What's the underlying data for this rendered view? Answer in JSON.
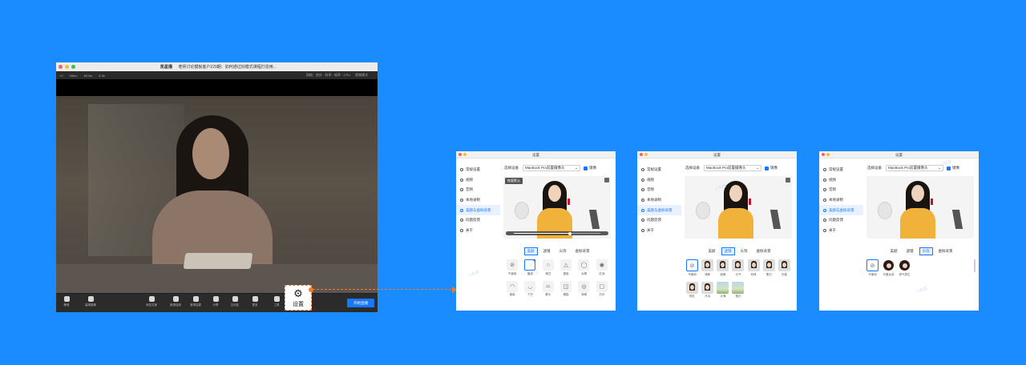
{
  "main_window": {
    "app_name": "凯星播",
    "title": "老师讨论模板客户229期：如何通过好模式课程打造用...",
    "status": {
      "signal": "+0",
      "viewers": "55fen",
      "likes": "89.5w",
      "comments": "5.3k",
      "network": "网络：良好 · 码率 · 帧率 · CPU",
      "mode": "视频模式"
    },
    "toolbar": {
      "items": [
        "静音",
        "高清摄像",
        "添加文案",
        "邀请连线",
        "邀请连麦",
        "分享",
        "互动区",
        "更多",
        "工具"
      ],
      "start_label": "开始直播"
    }
  },
  "callout": {
    "label": "设置"
  },
  "settings": {
    "title": "设置",
    "sidebar": [
      "常规设置",
      "视频",
      "音频",
      "本地录制",
      "美颜与虚拟背景",
      "问题反馈",
      "关于"
    ],
    "active_sidebar": "美颜与虚拟背景",
    "device_label": "选择设备",
    "device_value": "MacBook Pro前置摄像头",
    "mirror_label": "镜像",
    "preview_tag": "恢复默认",
    "watermark": "小鹅通",
    "tabs": [
      "美颜",
      "滤镜",
      "头饰",
      "虚拟背景"
    ],
    "beauty_items": [
      "不使用",
      "磨皮",
      "美白",
      "瘦脸",
      "大眼",
      "红润",
      "瘦鼻",
      "下巴",
      "额头",
      "眼距",
      "亮眼",
      "白牙"
    ],
    "filter_items": [
      "不使用",
      "清新",
      "甜美",
      "元气",
      "珍珠",
      "柔白",
      "白皙",
      "粉红",
      "冷淡",
      "大海",
      "落日"
    ],
    "head_items": [
      "不使用",
      "可爱女孩",
      "帅气男生"
    ]
  }
}
